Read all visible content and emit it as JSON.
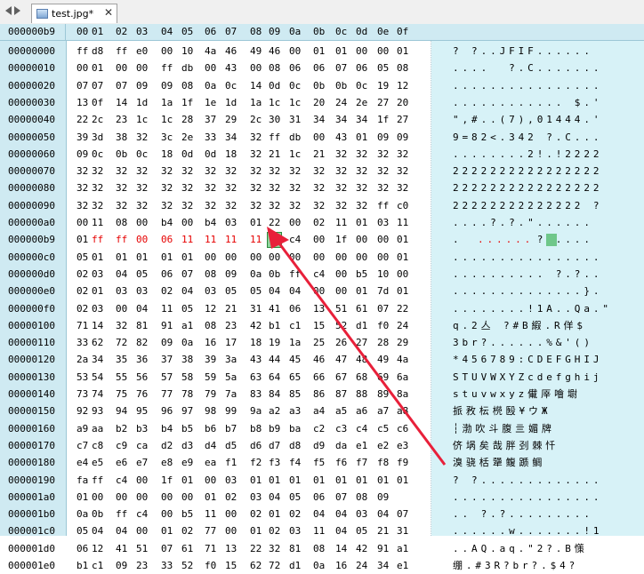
{
  "tab": {
    "title": "test.jpg*",
    "close": "✕"
  },
  "header": {
    "offset": "000000b9",
    "columns": [
      "00",
      "01",
      "02",
      "03",
      "04",
      "05",
      "06",
      "07",
      "08",
      "09",
      "0a",
      "0b",
      "0c",
      "0d",
      "0e",
      "0f"
    ]
  },
  "rows": [
    {
      "offset": "00000000",
      "hex": [
        "ff",
        "d8",
        "ff",
        "e0",
        "00",
        "10",
        "4a",
        "46",
        "49",
        "46",
        "00",
        "01",
        "01",
        "00",
        "00",
        "01"
      ],
      "ascii": "? ?..JFIF......"
    },
    {
      "offset": "00000010",
      "hex": [
        "00",
        "01",
        "00",
        "00",
        "ff",
        "db",
        "00",
        "43",
        "00",
        "08",
        "06",
        "06",
        "07",
        "06",
        "05",
        "08"
      ],
      "ascii": "....  ?.C......."
    },
    {
      "offset": "00000020",
      "hex": [
        "07",
        "07",
        "07",
        "09",
        "09",
        "08",
        "0a",
        "0c",
        "14",
        "0d",
        "0c",
        "0b",
        "0b",
        "0c",
        "19",
        "12"
      ],
      "ascii": "................"
    },
    {
      "offset": "00000030",
      "hex": [
        "13",
        "0f",
        "14",
        "1d",
        "1a",
        "1f",
        "1e",
        "1d",
        "1a",
        "1c",
        "1c",
        "20",
        "24",
        "2e",
        "27",
        "20"
      ],
      "ascii": "............ $.' "
    },
    {
      "offset": "00000040",
      "hex": [
        "22",
        "2c",
        "23",
        "1c",
        "1c",
        "28",
        "37",
        "29",
        "2c",
        "30",
        "31",
        "34",
        "34",
        "34",
        "1f",
        "27"
      ],
      "ascii": "\",#..(7),01444.'"
    },
    {
      "offset": "00000050",
      "hex": [
        "39",
        "3d",
        "38",
        "32",
        "3c",
        "2e",
        "33",
        "34",
        "32",
        "ff",
        "db",
        "00",
        "43",
        "01",
        "09",
        "09"
      ],
      "ascii": "9=82<.342 ?.C..."
    },
    {
      "offset": "00000060",
      "hex": [
        "09",
        "0c",
        "0b",
        "0c",
        "18",
        "0d",
        "0d",
        "18",
        "32",
        "21",
        "1c",
        "21",
        "32",
        "32",
        "32",
        "32"
      ],
      "ascii": "........2!.!2222"
    },
    {
      "offset": "00000070",
      "hex": [
        "32",
        "32",
        "32",
        "32",
        "32",
        "32",
        "32",
        "32",
        "32",
        "32",
        "32",
        "32",
        "32",
        "32",
        "32",
        "32"
      ],
      "ascii": "2222222222222222"
    },
    {
      "offset": "00000080",
      "hex": [
        "32",
        "32",
        "32",
        "32",
        "32",
        "32",
        "32",
        "32",
        "32",
        "32",
        "32",
        "32",
        "32",
        "32",
        "32",
        "32"
      ],
      "ascii": "2222222222222222"
    },
    {
      "offset": "00000090",
      "hex": [
        "32",
        "32",
        "32",
        "32",
        "32",
        "32",
        "32",
        "32",
        "32",
        "32",
        "32",
        "32",
        "32",
        "32",
        "ff",
        "c0"
      ],
      "ascii": "22222222222222 ?"
    },
    {
      "offset": "000000a0",
      "hex": [
        "00",
        "11",
        "08",
        "00",
        "b4",
        "00",
        "b4",
        "03",
        "01",
        "22",
        "00",
        "02",
        "11",
        "01",
        "03",
        "11"
      ],
      "ascii": "....?.?.\"......"
    },
    {
      "offset": "000000b9",
      "hex": [
        "01",
        "ff",
        "ff",
        "00",
        "06",
        "11",
        "11",
        "11",
        "11",
        "ff",
        "c4",
        "00",
        "1f",
        "00",
        "00",
        "01"
      ],
      "ascii": ".        ?.....",
      "selected": true
    },
    {
      "offset": "000000c0",
      "hex": [
        "05",
        "01",
        "01",
        "01",
        "01",
        "01",
        "00",
        "00",
        "00",
        "00",
        "00",
        "00",
        "00",
        "00",
        "00",
        "01"
      ],
      "ascii": "................"
    },
    {
      "offset": "000000d0",
      "hex": [
        "02",
        "03",
        "04",
        "05",
        "06",
        "07",
        "08",
        "09",
        "0a",
        "0b",
        "ff",
        "c4",
        "00",
        "b5",
        "10",
        "00"
      ],
      "ascii": ".......... ?.?.."
    },
    {
      "offset": "000000e0",
      "hex": [
        "02",
        "01",
        "03",
        "03",
        "02",
        "04",
        "03",
        "05",
        "05",
        "04",
        "04",
        "00",
        "00",
        "01",
        "7d",
        "01"
      ],
      "ascii": "..............}."
    },
    {
      "offset": "000000f0",
      "hex": [
        "02",
        "03",
        "00",
        "04",
        "11",
        "05",
        "12",
        "21",
        "31",
        "41",
        "06",
        "13",
        "51",
        "61",
        "07",
        "22"
      ],
      "ascii": "........!1A..Qa.\""
    },
    {
      "offset": "00000100",
      "hex": [
        "71",
        "14",
        "32",
        "81",
        "91",
        "a1",
        "08",
        "23",
        "42",
        "b1",
        "c1",
        "15",
        "52",
        "d1",
        "f0",
        "24"
      ],
      "ascii": "q.2亼 ?#B縀.R佯$"
    },
    {
      "offset": "00000110",
      "hex": [
        "33",
        "62",
        "72",
        "82",
        "09",
        "0a",
        "16",
        "17",
        "18",
        "19",
        "1a",
        "25",
        "26",
        "27",
        "28",
        "29"
      ],
      "ascii": "3br?......%&'()"
    },
    {
      "offset": "00000120",
      "hex": [
        "2a",
        "34",
        "35",
        "36",
        "37",
        "38",
        "39",
        "3a",
        "43",
        "44",
        "45",
        "46",
        "47",
        "48",
        "49",
        "4a"
      ],
      "ascii": "*456789:CDEFGHIJ"
    },
    {
      "offset": "00000130",
      "hex": [
        "53",
        "54",
        "55",
        "56",
        "57",
        "58",
        "59",
        "5a",
        "63",
        "64",
        "65",
        "66",
        "67",
        "68",
        "69",
        "6a"
      ],
      "ascii": "STUVWXYZcdefghij"
    },
    {
      "offset": "00000140",
      "hex": [
        "73",
        "74",
        "75",
        "76",
        "77",
        "78",
        "79",
        "7a",
        "83",
        "84",
        "85",
        "86",
        "87",
        "88",
        "89",
        "8a"
      ],
      "ascii": "stuvwxyz儎厗噲墛"
    },
    {
      "offset": "00000150",
      "hex": [
        "92",
        "93",
        "94",
        "95",
        "96",
        "97",
        "98",
        "99",
        "9a",
        "a2",
        "a3",
        "a4",
        "a5",
        "a6",
        "a7",
        "a8"
      ],
      "ascii": "挀敄枟橩殹¥ウЖ"
    },
    {
      "offset": "00000160",
      "hex": [
        "a9",
        "aa",
        "b2",
        "b3",
        "b4",
        "b5",
        "b6",
        "b7",
        "b8",
        "b9",
        "ba",
        "c2",
        "c3",
        "c4",
        "c5",
        "c6"
      ],
      "ascii": "┆渤吹斗腹亖媚牌"
    },
    {
      "offset": "00000170",
      "hex": [
        "c7",
        "c8",
        "c9",
        "ca",
        "d2",
        "d3",
        "d4",
        "d5",
        "d6",
        "d7",
        "d8",
        "d9",
        "da",
        "e1",
        "e2",
        "e3"
      ],
      "ascii": "侪埚矣哉胖刭棘忏"
    },
    {
      "offset": "00000180",
      "hex": [
        "e4",
        "e5",
        "e6",
        "e7",
        "e8",
        "e9",
        "ea",
        "f1",
        "f2",
        "f3",
        "f4",
        "f5",
        "f6",
        "f7",
        "f8",
        "f9"
      ],
      "ascii": "溴骁栝犟鳆踬鲷"
    },
    {
      "offset": "00000190",
      "hex": [
        "fa",
        "ff",
        "c4",
        "00",
        "1f",
        "01",
        "00",
        "03",
        "01",
        "01",
        "01",
        "01",
        "01",
        "01",
        "01",
        "01"
      ],
      "ascii": "? ?............."
    },
    {
      "offset": "000001a0",
      "hex": [
        "01",
        "00",
        "00",
        "00",
        "00",
        "00",
        "01",
        "02",
        "03",
        "04",
        "05",
        "06",
        "07",
        "08",
        "09"
      ],
      "ascii": "................"
    },
    {
      "offset": "000001b0",
      "hex": [
        "0a",
        "0b",
        "ff",
        "c4",
        "00",
        "b5",
        "11",
        "00",
        "02",
        "01",
        "02",
        "04",
        "04",
        "03",
        "04",
        "07"
      ],
      "ascii": ".. ?.?........."
    },
    {
      "offset": "000001c0",
      "hex": [
        "05",
        "04",
        "04",
        "00",
        "01",
        "02",
        "77",
        "00",
        "01",
        "02",
        "03",
        "11",
        "04",
        "05",
        "21",
        "31"
      ],
      "ascii": "......w.......!1"
    },
    {
      "offset": "000001d0",
      "hex": [
        "06",
        "12",
        "41",
        "51",
        "07",
        "61",
        "71",
        "13",
        "22",
        "32",
        "81",
        "08",
        "14",
        "42",
        "91",
        "a1"
      ],
      "ascii": "..AQ.aq.\"2?.B憡"
    },
    {
      "offset": "000001e0",
      "hex": [
        "b1",
        "c1",
        "09",
        "23",
        "33",
        "52",
        "f0",
        "15",
        "62",
        "72",
        "d1",
        "0a",
        "16",
        "24",
        "34",
        "e1"
      ],
      "ascii": "绷.#3R?br?.$4?"
    }
  ],
  "colors": {
    "header_bg": "#cfeaf2",
    "ascii_bg": "#d7f2f7",
    "changed_text": "#e60000",
    "cursor_green": "#8fd39c",
    "arrow_red": "#e8203a"
  },
  "icons": [
    "chevron-left-icon",
    "chevron-right-icon",
    "file-icon",
    "close-icon"
  ]
}
